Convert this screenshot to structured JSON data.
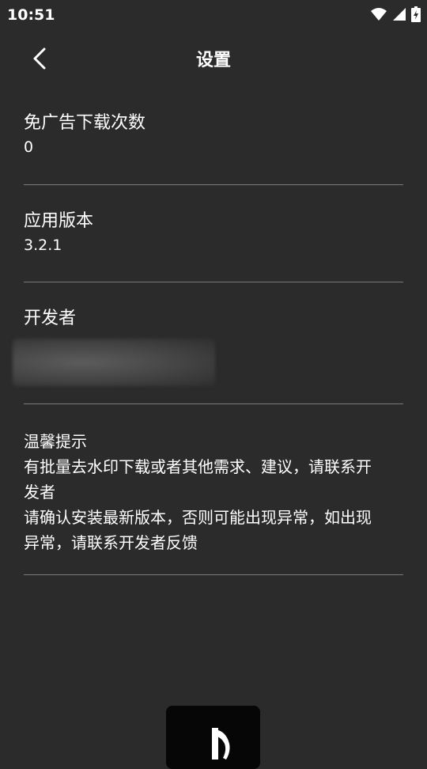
{
  "status_bar": {
    "time": "10:51"
  },
  "header": {
    "title": "设置"
  },
  "settings": {
    "free_ad_downloads": {
      "label": "免广告下载次数",
      "value": "0"
    },
    "app_version": {
      "label": "应用版本",
      "value": "3.2.1"
    },
    "developer": {
      "label": "开发者"
    },
    "tips": {
      "label": "温馨提示",
      "lines": [
        "有批量去水印下载或者其他需求、建议，请联系开",
        "发者",
        "请确认安装最新版本，否则可能出现异常，如出现",
        "异常，请联系开发者反馈"
      ]
    }
  },
  "colors": {
    "background": "#2b2b2b",
    "text": "#ffffff",
    "divider": "#7a7a7a"
  },
  "icons": {
    "back": "chevron-left-icon",
    "wifi": "wifi-icon",
    "signal": "signal-icon",
    "battery": "battery-charging-icon",
    "app": "music-note-icon"
  }
}
